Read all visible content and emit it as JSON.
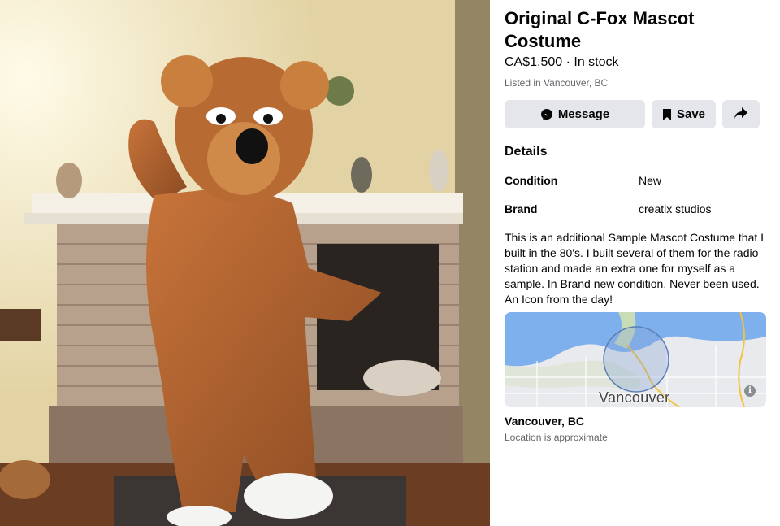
{
  "listing": {
    "title": "Original C-Fox Mascot Costume",
    "price_stock": "CA$1,500 · In stock",
    "listed_in": "Listed in Vancouver, BC"
  },
  "actions": {
    "message_label": "Message",
    "save_label": "Save",
    "message_icon": "messenger-icon",
    "save_icon": "bookmark-icon",
    "share_icon": "share-arrow-icon"
  },
  "details": {
    "heading": "Details",
    "rows": [
      {
        "label": "Condition",
        "value": "New"
      },
      {
        "label": "Brand",
        "value": "creatix studios"
      }
    ],
    "description": "This is an additional Sample Mascot Costume that I built in the 80's. I built several of them for the radio station and made an extra one for myself as a sample. In Brand new condition, Never been used. An Icon from the day!"
  },
  "map": {
    "label": "Vancouver",
    "info_glyph": "i"
  },
  "location": {
    "city": "Vancouver, BC",
    "note": "Location is approximate"
  },
  "colors": {
    "button_bg": "#e4e6eb",
    "secondary_text": "#65676b",
    "water": "#7fb0ee",
    "map_circle": "#5b7fb5"
  }
}
